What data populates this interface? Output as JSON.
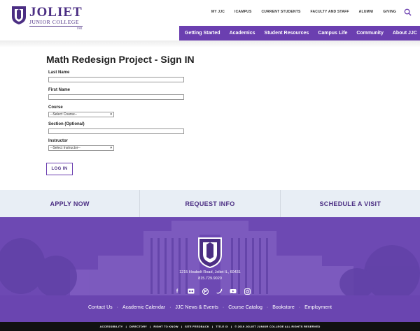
{
  "logo": {
    "name": "JOLIET",
    "college": "JUNIOR COLLEGE",
    "year": "1901"
  },
  "utility_nav": [
    "MY JJC",
    "ICAMPUS",
    "CURRENT STUDENTS",
    "FACULTY AND STAFF",
    "ALUMNI",
    "GIVING"
  ],
  "main_nav": [
    "Getting Started",
    "Academics",
    "Student Resources",
    "Campus Life",
    "Community",
    "About JJC"
  ],
  "form": {
    "title": "Math Redesign Project - Sign IN",
    "last_name_label": "Last Name",
    "first_name_label": "First Name",
    "course_label": "Course",
    "course_value": "--Select Course--",
    "section_label": "Section (Optional)",
    "instructor_label": "Instructor",
    "instructor_value": "--Select Instructor--",
    "login_label": "LOG IN"
  },
  "cta": [
    "APPLY NOW",
    "REQUEST INFO",
    "SCHEDULE A VISIT"
  ],
  "footer": {
    "address": "1215 Houbolt Road, Joliet IL, 60431",
    "phone": "815.729.9020",
    "links": [
      "Contact Us",
      "Academic Calendar",
      "JJC News & Events",
      "Course Catalog",
      "Bookstore",
      "Employment"
    ],
    "bottom": [
      "ACCESSIBILITY",
      "DIRECTORY",
      "RIGHT TO KNOW",
      "SITE FEEDBACK",
      "TITLE IX",
      "© 2019 JOLIET JUNIOR COLLEGE ALL RIGHTS RESERVED"
    ]
  },
  "socials": [
    "facebook-icon",
    "flickr-icon",
    "pinterest-icon",
    "twitter-icon",
    "youtube-icon",
    "instagram-icon"
  ],
  "colors": {
    "primary": "#6b3fb0",
    "dark": "#4b2e83",
    "cta_bg": "#e8eef5"
  }
}
